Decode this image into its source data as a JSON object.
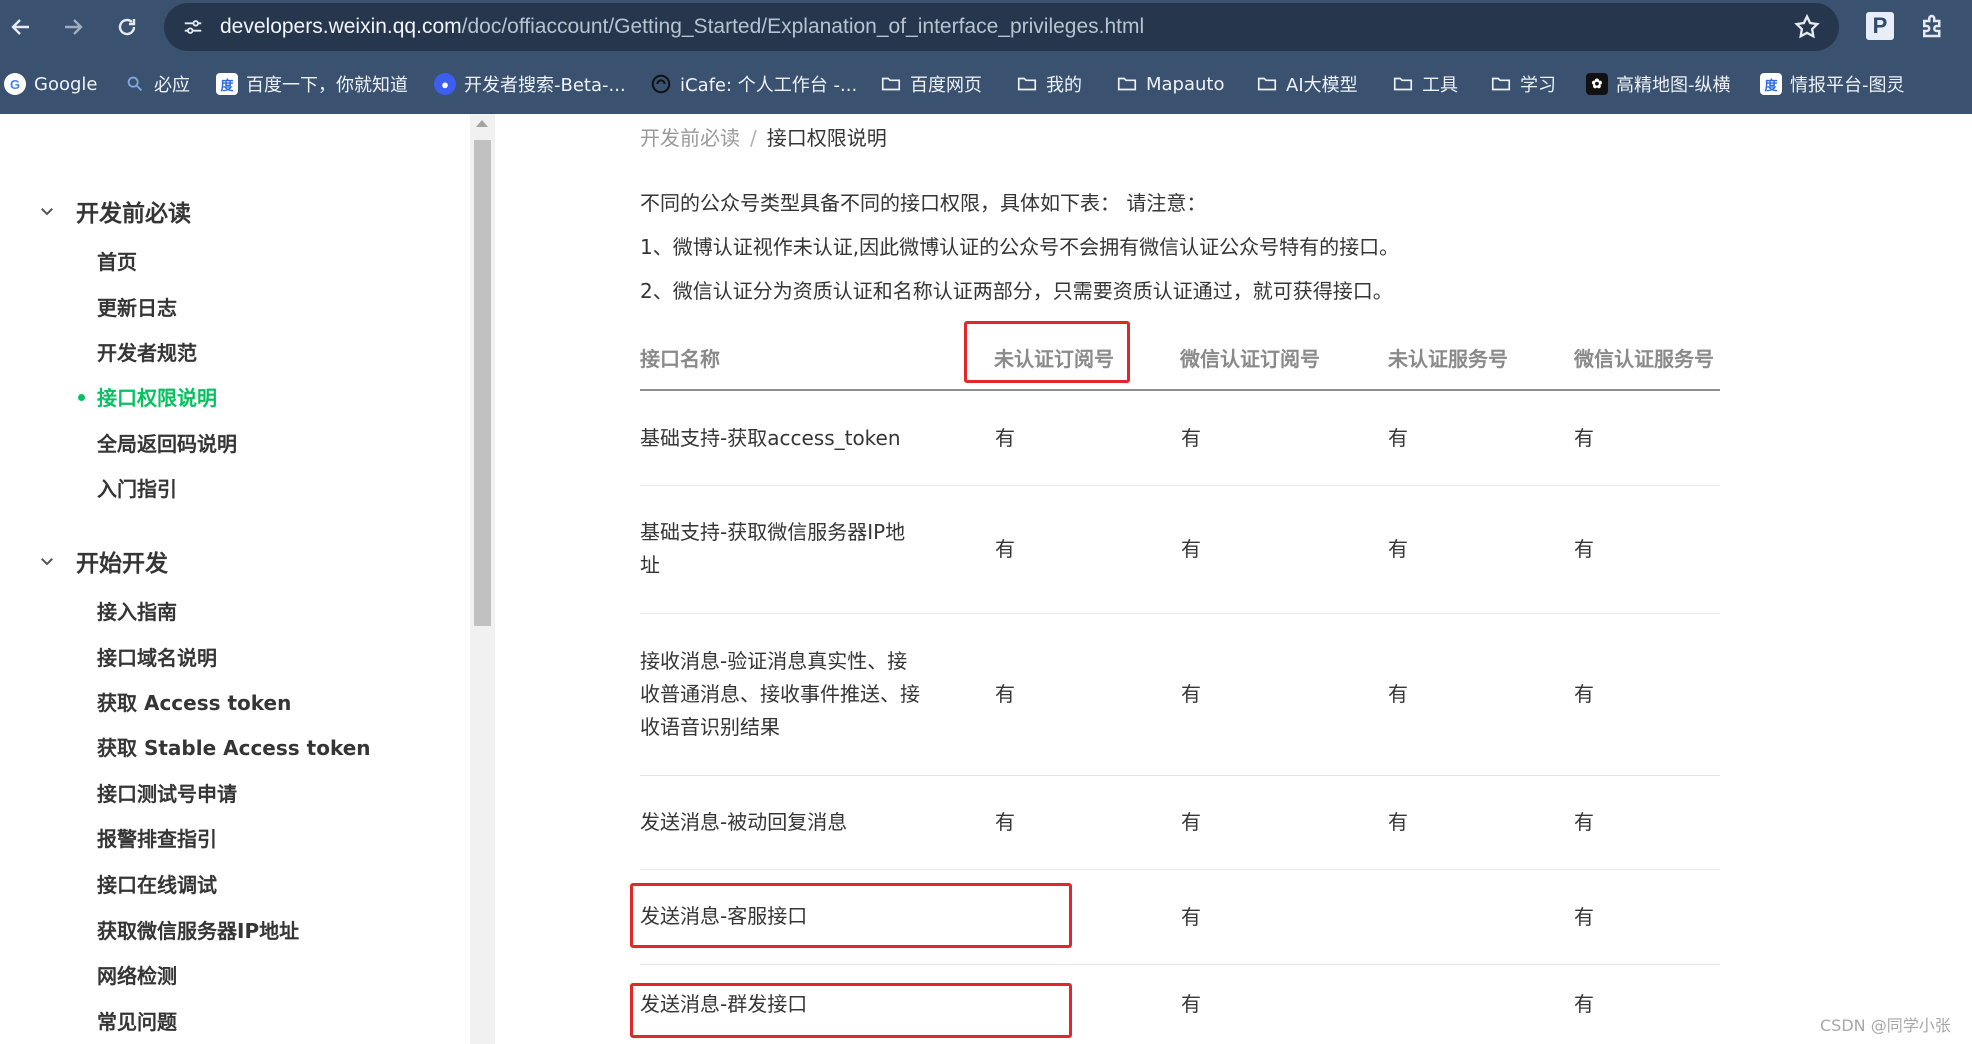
{
  "browser": {
    "url_host": "developers.weixin.qq.com",
    "url_path": "/doc/offiaccount/Getting_Started/Explanation_of_interface_privileges.html",
    "extension_p_label": "P"
  },
  "bookmarks": [
    {
      "label": "Google",
      "icon": "google-icon"
    },
    {
      "label": "必应",
      "icon": "bing-icon"
    },
    {
      "label": "百度一下，你就知道",
      "icon": "baidu-icon"
    },
    {
      "label": "开发者搜索-Beta-...",
      "icon": "search-icon"
    },
    {
      "label": "iCafe: 个人工作台 -...",
      "icon": "icafe-icon"
    },
    {
      "label": "百度网页",
      "icon": "folder-icon"
    },
    {
      "label": "我的",
      "icon": "folder-icon"
    },
    {
      "label": "Mapauto",
      "icon": "folder-icon"
    },
    {
      "label": "AI大模型",
      "icon": "folder-icon"
    },
    {
      "label": "工具",
      "icon": "folder-icon"
    },
    {
      "label": "学习",
      "icon": "folder-icon"
    },
    {
      "label": "高精地图-纵横",
      "icon": "paw-icon"
    },
    {
      "label": "情报平台-图灵",
      "icon": "baidu-icon"
    }
  ],
  "sidebar": {
    "section1": {
      "title": "开发前必读",
      "items": [
        "首页",
        "更新日志",
        "开发者规范",
        "接口权限说明",
        "全局返回码说明",
        "入门指引"
      ]
    },
    "section2": {
      "title": "开始开发",
      "items": [
        "接入指南",
        "接口域名说明",
        "获取 Access token",
        "获取 Stable Access token",
        "接口测试号申请",
        "报警排查指引",
        "接口在线调试",
        "获取微信服务器IP地址",
        "网络检测",
        "常见问题"
      ]
    }
  },
  "breadcrumb": {
    "parent": "开发前必读",
    "separator": "/",
    "current": "接口权限说明"
  },
  "intro": [
    "不同的公众号类型具备不同的接口权限，具体如下表： 请注意：",
    "1、微博认证视作未认证,因此微博认证的公众号不会拥有微信认证公众号特有的接口。",
    "2、微信认证分为资质认证和名称认证两部分，只需要资质认证通过，就可获得接口。"
  ],
  "table": {
    "headers": [
      "接口名称",
      "未认证订阅号",
      "微信认证订阅号",
      "未认证服务号",
      "微信认证服务号"
    ],
    "rows": [
      {
        "name": [
          "基础支持-获取access_token"
        ],
        "values": [
          "有",
          "有",
          "有",
          "有"
        ]
      },
      {
        "name": [
          "基础支持-获取微信服务器IP地",
          "址"
        ],
        "values": [
          "有",
          "有",
          "有",
          "有"
        ]
      },
      {
        "name": [
          "接收消息-验证消息真实性、接",
          "收普通消息、接收事件推送、接",
          "收语音识别结果"
        ],
        "values": [
          "有",
          "有",
          "有",
          "有"
        ]
      },
      {
        "name": [
          "发送消息-被动回复消息"
        ],
        "values": [
          "有",
          "有",
          "有",
          "有"
        ]
      },
      {
        "name": [
          "发送消息-客服接口"
        ],
        "values": [
          "",
          "有",
          "",
          "有"
        ]
      },
      {
        "name": [
          "发送消息-群发接口"
        ],
        "values": [
          "",
          "有",
          "",
          "有"
        ]
      }
    ]
  },
  "watermark": "CSDN @同学小张",
  "colors": {
    "accent": "#07c160",
    "highlight": "#e3262b",
    "chrome": "#3a5170"
  }
}
